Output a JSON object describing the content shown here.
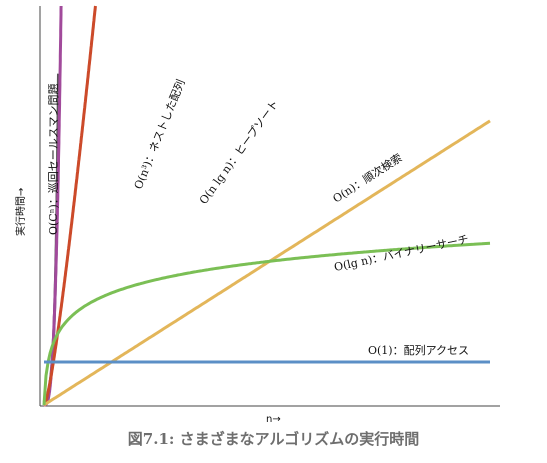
{
  "caption": "図7.1: さまざまなアルゴリズムの実行時間",
  "chart_data": {
    "type": "line",
    "xlabel": "n→",
    "ylabel": "実行時間→",
    "grid": false,
    "legend": "labels placed along each curve",
    "series": [
      {
        "name": "O(Cⁿ)：巡回セールスマン問題",
        "color": "#555555",
        "curve": "exponential"
      },
      {
        "name": "O(n³)：ネストした配列",
        "color": "#a14a9b",
        "curve": "cubic"
      },
      {
        "name": "O(n lg n)：ヒープソート",
        "color": "#cc4a2a",
        "curve": "n log n"
      },
      {
        "name": "O(n)：順次検索",
        "color": "#e3b65a",
        "curve": "linear"
      },
      {
        "name": "O(lg n)：バイナリーサーチ",
        "color": "#7bbf55",
        "curve": "logarithmic"
      },
      {
        "name": "O(1)：配列アクセス",
        "color": "#5b8fc6",
        "curve": "constant"
      }
    ]
  }
}
